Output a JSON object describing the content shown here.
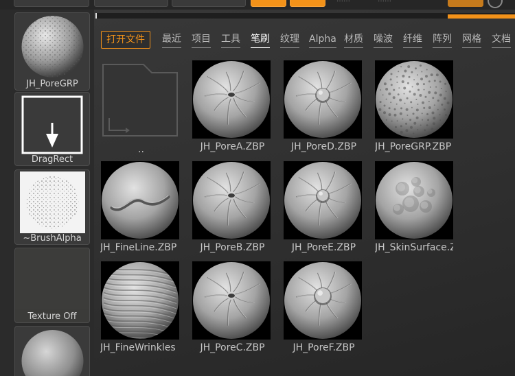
{
  "toolbar": {
    "faded_labels": [
      "……",
      "……"
    ]
  },
  "left_palette": [
    {
      "label": "JH_PoreGRP",
      "icon": "pore-sphere-thumbnail"
    },
    {
      "label": "DragRect",
      "icon": "drag-rect-arrow-icon"
    },
    {
      "label": "~BrushAlpha",
      "icon": "brush-alpha-thumbnail"
    },
    {
      "label": "Texture Off",
      "icon": "texture-off-swatch"
    },
    {
      "label": "",
      "icon": "material-sphere-thumbnail"
    }
  ],
  "file_panel": {
    "open_file_label": "打开文件",
    "tabs": [
      "最近",
      "项目",
      "工具",
      "笔刷",
      "纹理",
      "Alpha",
      "材质",
      "噪波",
      "纤维",
      "阵列",
      "网格",
      "文档"
    ],
    "active_tab": "笔刷",
    "load_progress": 0.16,
    "parent_folder_label": "..",
    "items": [
      {
        "name": "JH_PoreA.ZBP",
        "style": "pore-a"
      },
      {
        "name": "JH_PoreD.ZBP",
        "style": "pore-d"
      },
      {
        "name": "JH_PoreGRP.ZBP",
        "style": "pore-grp"
      },
      {
        "name": "JH_FineLine.ZBP",
        "style": "fine-line"
      },
      {
        "name": "JH_PoreB.ZBP",
        "style": "pore-b"
      },
      {
        "name": "JH_PoreE.ZBP",
        "style": "pore-e"
      },
      {
        "name": "JH_SkinSurface.ZBP",
        "style": "skin-surface"
      },
      {
        "name": "JH_FineWrinkles",
        "style": "fine-wrinkles"
      },
      {
        "name": "JH_PoreC.ZBP",
        "style": "pore-c"
      },
      {
        "name": "JH_PoreF.ZBP",
        "style": "pore-f"
      }
    ]
  },
  "colors": {
    "accent": "#f39219",
    "panel_bg": "#2f2f2f",
    "text": "#c6c6c6"
  }
}
